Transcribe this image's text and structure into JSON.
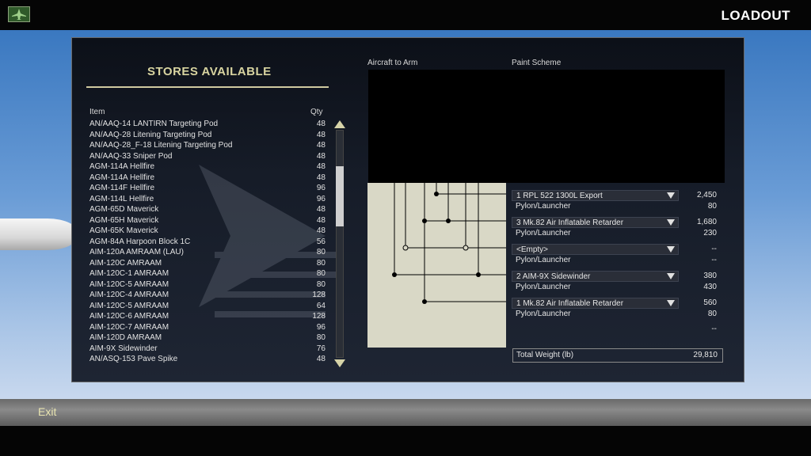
{
  "header": {
    "title": "LOADOUT",
    "home_icon": "aircraft-icon"
  },
  "stores": {
    "title": "STORES AVAILABLE",
    "col_item": "Item",
    "col_qty": "Qty",
    "items": [
      {
        "name": "AN/AAQ-14 LANTIRN Targeting Pod",
        "qty": "48"
      },
      {
        "name": "AN/AAQ-28 Litening Targeting Pod",
        "qty": "48"
      },
      {
        "name": "AN/AAQ-28_F-18 Litening Targeting Pod",
        "qty": "48"
      },
      {
        "name": "AN/AAQ-33 Sniper Pod",
        "qty": "48"
      },
      {
        "name": "AGM-114A Hellfire",
        "qty": "48"
      },
      {
        "name": "AGM-114A Hellfire",
        "qty": "48"
      },
      {
        "name": "AGM-114F Hellfire",
        "qty": "96"
      },
      {
        "name": "AGM-114L Hellfire",
        "qty": "96"
      },
      {
        "name": "AGM-65D Maverick",
        "qty": "48"
      },
      {
        "name": "AGM-65H Maverick",
        "qty": "48"
      },
      {
        "name": "AGM-65K Maverick",
        "qty": "48"
      },
      {
        "name": "AGM-84A Harpoon Block 1C",
        "qty": "56"
      },
      {
        "name": "AIM-120A AMRAAM (LAU)",
        "qty": "80"
      },
      {
        "name": "AIM-120C AMRAAM",
        "qty": "80"
      },
      {
        "name": "AIM-120C-1 AMRAAM",
        "qty": "80"
      },
      {
        "name": "AIM-120C-5  AMRAAM",
        "qty": "80"
      },
      {
        "name": "AIM-120C-4 AMRAAM",
        "qty": "128"
      },
      {
        "name": "AIM-120C-5 AMRAAM",
        "qty": "64"
      },
      {
        "name": "AIM-120C-6 AMRAAM",
        "qty": "128"
      },
      {
        "name": "AIM-120C-7 AMRAAM",
        "qty": "96"
      },
      {
        "name": "AIM-120D AMRAAM",
        "qty": "80"
      },
      {
        "name": "AIM-9X Sidewinder",
        "qty": "76"
      },
      {
        "name": "AN/ASQ-153 Pave Spike",
        "qty": "48"
      }
    ]
  },
  "arming": {
    "aircraft_label": "Aircraft to Arm",
    "paint_label": "Paint Scheme",
    "stations": [
      {
        "store": "1 RPL 522 1300L Export",
        "weight": "2,450",
        "pylon": "Pylon/Launcher",
        "pylon_weight": "80"
      },
      {
        "store": "3 Mk.82 Air Inflatable Retarder",
        "weight": "1,680",
        "pylon": "Pylon/Launcher",
        "pylon_weight": "230"
      },
      {
        "store": "<Empty>",
        "weight": "--",
        "pylon": "Pylon/Launcher",
        "pylon_weight": "--"
      },
      {
        "store": "2 AIM-9X Sidewinder",
        "weight": "380",
        "pylon": "Pylon/Launcher",
        "pylon_weight": "430"
      },
      {
        "store": "1 Mk.82 Air Inflatable Retarder",
        "weight": "560",
        "pylon": "Pylon/Launcher",
        "pylon_weight": "80"
      }
    ],
    "extra_weight": "--",
    "total_label": "Total Weight (lb)",
    "total_value": "29,810"
  },
  "footer": {
    "exit_label": "Exit"
  }
}
